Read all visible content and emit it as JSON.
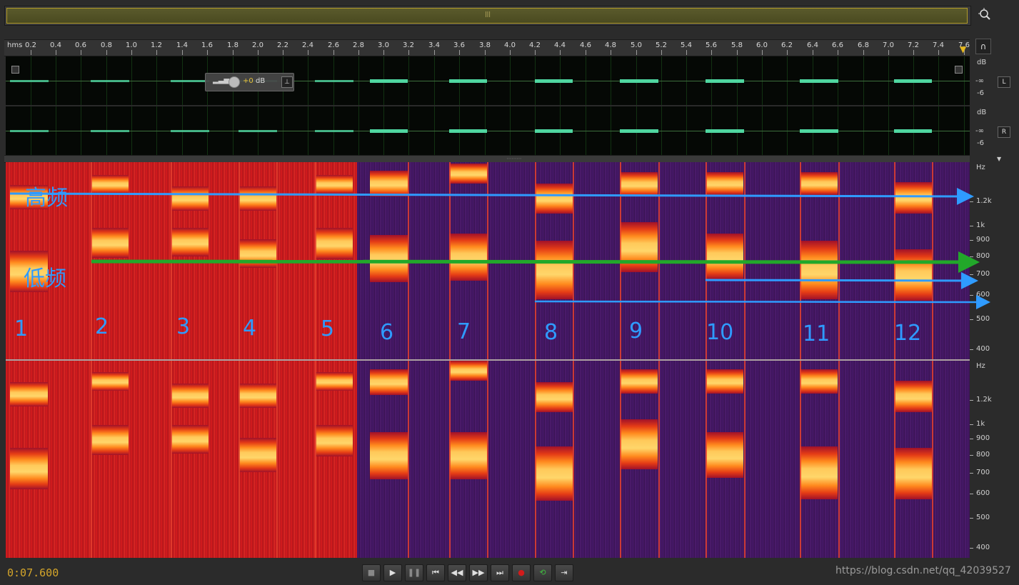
{
  "ruler": {
    "unit": "hms",
    "ticks": [
      "0.2",
      "0.4",
      "0.6",
      "0.8",
      "1.0",
      "1.2",
      "1.4",
      "1.6",
      "1.8",
      "2.0",
      "2.2",
      "2.4",
      "2.6",
      "2.8",
      "3.0",
      "3.2",
      "3.4",
      "3.6",
      "3.8",
      "4.0",
      "4.2",
      "4.4",
      "4.6",
      "4.8",
      "5.0",
      "5.2",
      "5.4",
      "5.6",
      "5.8",
      "6.0",
      "6.2",
      "6.4",
      "6.6",
      "6.8",
      "7.0",
      "7.2",
      "7.4",
      "7.6"
    ]
  },
  "waveform": {
    "hud_value": "+0",
    "hud_unit": "dB",
    "db_unit": "dB",
    "db_neg_inf": "-∞",
    "db_minus6": "-6",
    "channel_left": "L",
    "channel_right": "R"
  },
  "spectrogram": {
    "hz_unit": "Hz",
    "freq_labels": [
      "1.2k",
      "1k",
      "900",
      "800",
      "700",
      "600",
      "500",
      "400"
    ],
    "annotations": {
      "high_label": "高频",
      "low_label": "低频",
      "numbers": [
        "1",
        "2",
        "3",
        "4",
        "5",
        "6",
        "7",
        "8",
        "9",
        "10",
        "11",
        "12"
      ]
    }
  },
  "transport": {
    "time": "0:07.600",
    "buttons": [
      "stop",
      "play",
      "pause",
      "go-to-start",
      "rewind",
      "fast-forward",
      "go-to-end",
      "record",
      "loop",
      "skip-selection"
    ]
  },
  "watermark": "https://blog.csdn.net/qq_42039527",
  "colors": {
    "accent_time": "#d4a52a",
    "annotation_blue": "#2f9bff",
    "annotation_green": "#22a82a",
    "waveform": "#4fd6a0",
    "spectro_noise_red": "#c2171c",
    "spectro_bg_purple": "#3d1560"
  }
}
